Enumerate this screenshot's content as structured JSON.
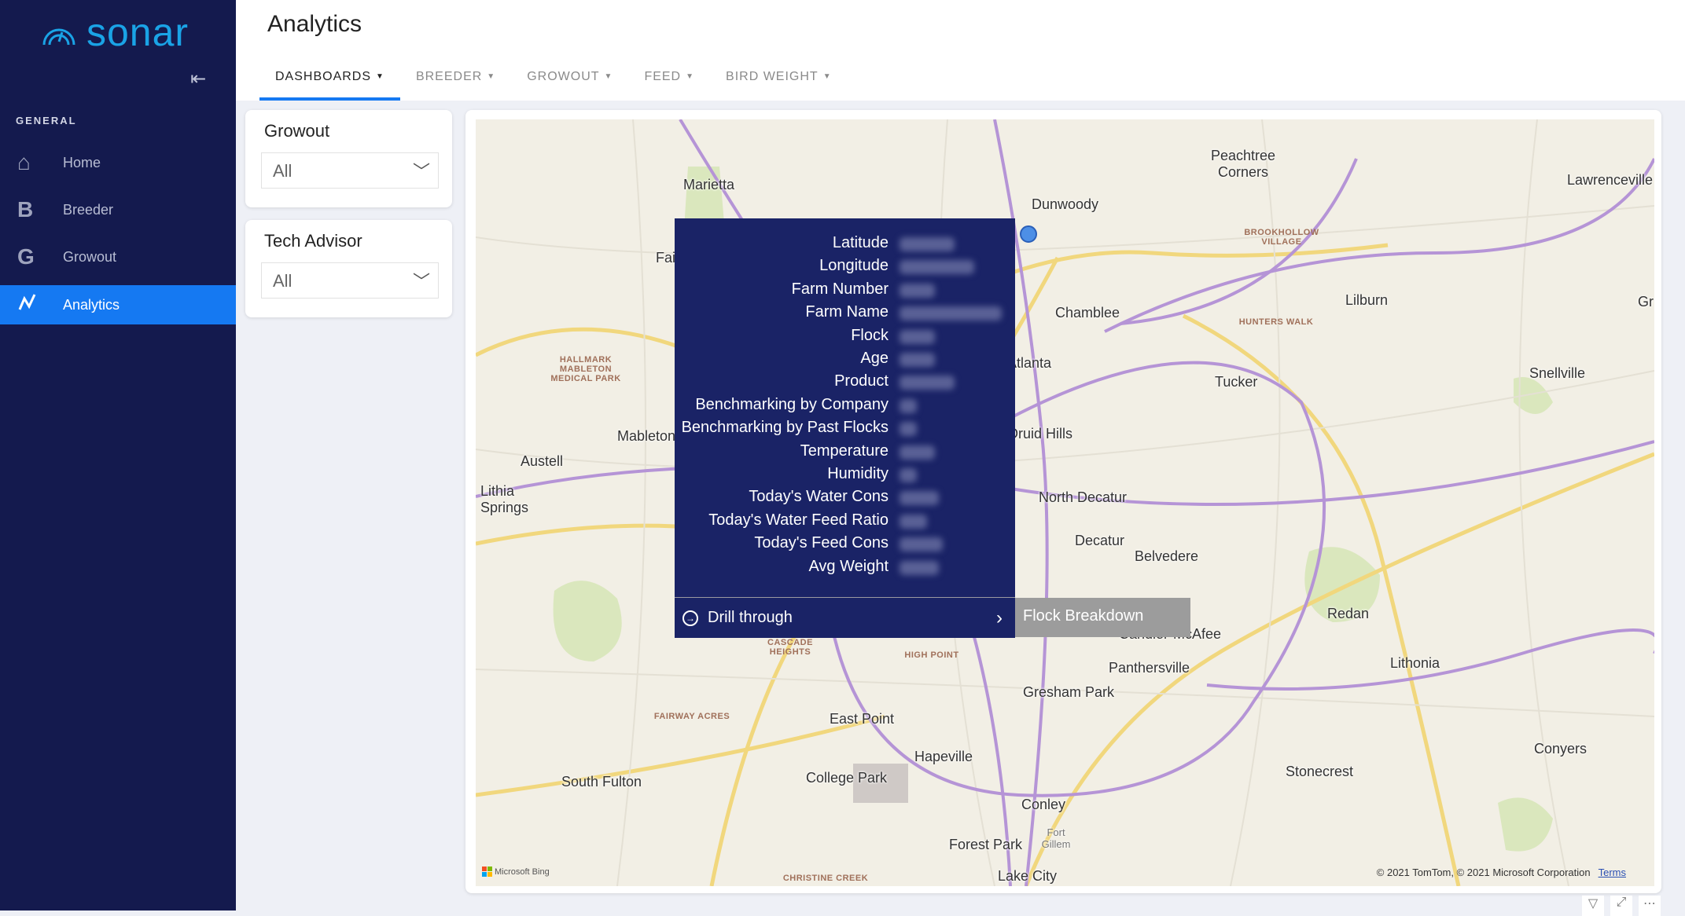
{
  "sidebar": {
    "logo": "sonar",
    "section": "GENERAL",
    "items": [
      {
        "label": "Home",
        "icon": "home-icon"
      },
      {
        "label": "Breeder",
        "letter": "B"
      },
      {
        "label": "Growout",
        "letter": "G"
      },
      {
        "label": "Analytics",
        "icon": "line-chart-icon",
        "active": true
      }
    ]
  },
  "header": {
    "title": "Analytics",
    "tabs": [
      {
        "label": "DASHBOARDS",
        "active": true
      },
      {
        "label": "BREEDER"
      },
      {
        "label": "GROWOUT"
      },
      {
        "label": "FEED"
      },
      {
        "label": "BIRD WEIGHT"
      }
    ]
  },
  "filters": [
    {
      "title": "Growout",
      "value": "All"
    },
    {
      "title": "Tech Advisor",
      "value": "All"
    }
  ],
  "tooltip": {
    "fields": [
      "Latitude",
      "Longitude",
      "Farm Number",
      "Farm Name",
      "Flock",
      "Age",
      "Product",
      "Benchmarking by Company",
      "Benchmarking by Past Flocks",
      "Temperature",
      "Humidity",
      "Today's Water Cons",
      "Today's Water Feed Ratio",
      "Today's Feed Cons",
      "Avg Weight"
    ],
    "drill_through": "Drill through",
    "drill_target": "Flock Breakdown"
  },
  "map": {
    "cities": [
      "Marietta",
      "Dunwoody",
      "Peachtree Corners",
      "Lawrenceville",
      "Chamblee",
      "Lilburn",
      "Gr",
      "Tucker",
      "Snellville",
      "North Atlanta",
      "North Druid Hills",
      "Mableton",
      "Austell",
      "Lithia Springs",
      "North Decatur",
      "Decatur",
      "Belvedere",
      "Redan",
      "Candler-McAfee",
      "Panthersville",
      "Lithonia",
      "Gresham Park",
      "East Point",
      "Hapeville",
      "College Park",
      "South Fulton",
      "Conley",
      "Stonecrest",
      "Conyers",
      "Forest Park",
      "Lake City",
      "Fort Gillem",
      "Fair Oaks"
    ],
    "neighborhoods": [
      "Hallmark Mableton Medical Park",
      "Brookhollow Village",
      "Hunters Walk",
      "Cascade Heights",
      "High Point",
      "Fairway Acres",
      "Christine Creek"
    ],
    "attribution": "© 2021 TomTom, © 2021 Microsoft Corporation",
    "terms": "Terms",
    "provider": "Microsoft Bing"
  },
  "colors": {
    "sidebar": "#141a4e",
    "accent": "#1579f2",
    "tooltip": "#1a2366",
    "logo": "#1aa3e6"
  }
}
